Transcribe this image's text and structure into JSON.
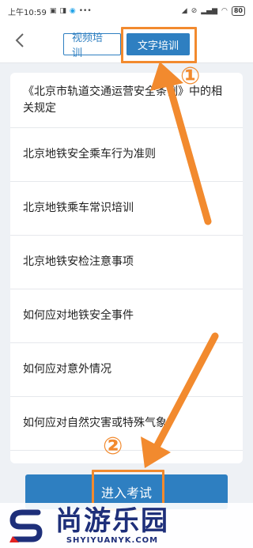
{
  "status_bar": {
    "time": "上午10:59",
    "battery": "80",
    "icons": [
      "message-icon",
      "notification-icon",
      "chat-icon",
      "more-icon",
      "location-icon",
      "silent-icon",
      "signal-icon",
      "wifi-icon",
      "battery-icon"
    ]
  },
  "header": {
    "back_icon": "chevron-left-icon",
    "tabs": [
      {
        "label": "视频培训",
        "active": false
      },
      {
        "label": "文字培训",
        "active": true
      }
    ]
  },
  "list": {
    "items": [
      "《北京市轨道交通运营安全条例》中的相关规定",
      "北京地铁安全乘车行为准则",
      "北京地铁乘车常识培训",
      "北京地铁安检注意事项",
      "如何应对地铁安全事件",
      "如何应对意外情况",
      "如何应对自然灾害或特殊气象？"
    ]
  },
  "footer": {
    "enter_button": "进入考试"
  },
  "annotations": {
    "step1": "①",
    "step2": "②",
    "color": "#f28a2e"
  },
  "watermark": {
    "title": "尚游乐园",
    "subtitle": "SHYIYUANYK.COM"
  },
  "colors": {
    "primary": "#2e7fc1",
    "accent": "#f28a2e",
    "watermark": "#1e2f7a"
  }
}
